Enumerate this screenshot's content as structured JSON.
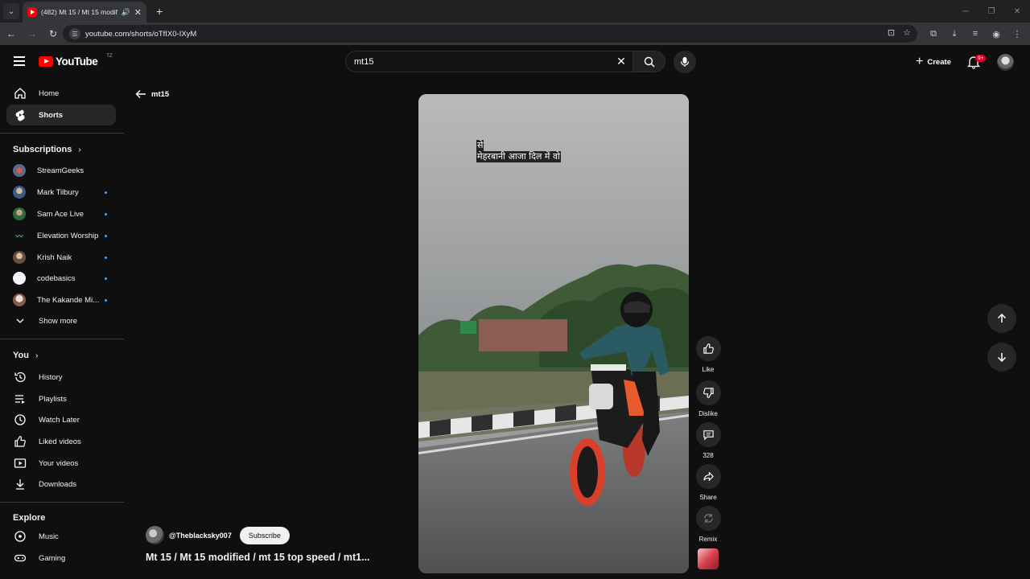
{
  "browser": {
    "tab_title": "(482) Mt 15 / Mt 15 modifie",
    "url": "youtube.com/shorts/oTfIX0-IXyM"
  },
  "masthead": {
    "logo_text": "YouTube",
    "country_code": "TZ",
    "search_value": "mt15",
    "create_label": "Create",
    "notification_badge": "9+"
  },
  "sidebar": {
    "primary": [
      {
        "label": "Home",
        "icon": "home-icon"
      },
      {
        "label": "Shorts",
        "icon": "shorts-icon",
        "active": true
      }
    ],
    "subscriptions_header": "Subscriptions",
    "subscriptions": [
      {
        "label": "StreamGeeks",
        "new": false
      },
      {
        "label": "Mark Tilbury",
        "new": true
      },
      {
        "label": "Sam Ace Live",
        "new": true
      },
      {
        "label": "Elevation Worship",
        "new": true
      },
      {
        "label": "Krish Naik",
        "new": true
      },
      {
        "label": "codebasics",
        "new": true
      },
      {
        "label": "The Kakande Mi...",
        "new": true
      }
    ],
    "show_more": "Show more",
    "you_header": "You",
    "you_items": [
      {
        "label": "History",
        "icon": "history-icon"
      },
      {
        "label": "Playlists",
        "icon": "playlists-icon"
      },
      {
        "label": "Watch Later",
        "icon": "clock-icon"
      },
      {
        "label": "Liked videos",
        "icon": "thumbs-up-icon"
      },
      {
        "label": "Your videos",
        "icon": "video-icon"
      },
      {
        "label": "Downloads",
        "icon": "download-icon"
      }
    ],
    "explore_header": "Explore",
    "explore_items": [
      {
        "label": "Music",
        "icon": "music-icon"
      },
      {
        "label": "Gaming",
        "icon": "gaming-icon"
      }
    ]
  },
  "main": {
    "back_label": "mt15",
    "caption_line1": "से",
    "caption_line2": "मेहरबानी आजा दिल में वो",
    "actions": {
      "like": "Like",
      "dislike": "Dislike",
      "comments": "328",
      "share": "Share",
      "remix": "Remix"
    },
    "channel_name": "@Theblacksky007",
    "subscribe_label": "Subscribe",
    "video_title": "Mt 15 / Mt 15 modified / mt 15 top speed / mt1..."
  }
}
